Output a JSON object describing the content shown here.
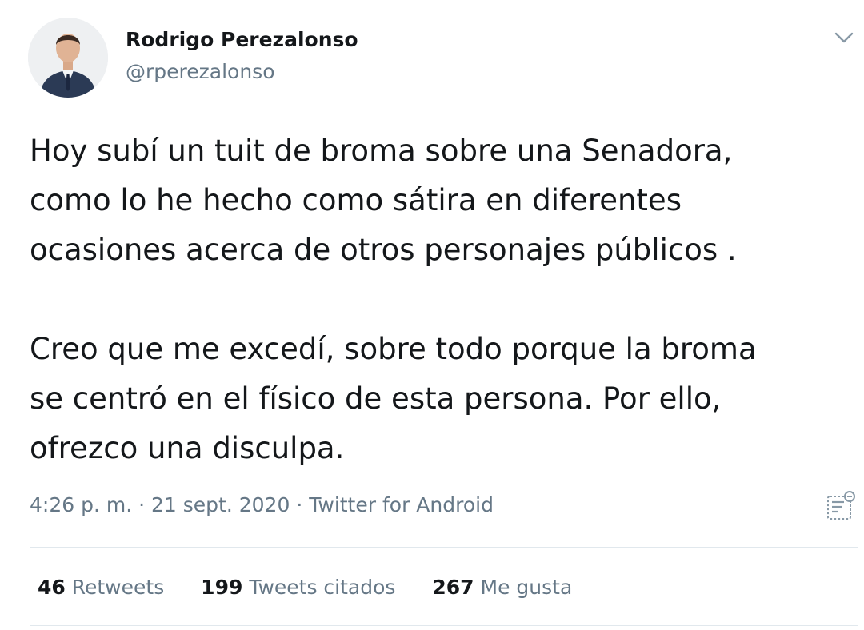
{
  "author": {
    "display_name": "Rodrigo Perezalonso",
    "handle": "@rperezalonso",
    "avatar_icon": "profile-photo"
  },
  "tweet": {
    "text": "Hoy subí un tuit de broma sobre una Senadora,\ncomo lo he hecho como sátira en diferentes\nocasiones acerca de otros personajes públicos .\n\nCreo que me excedí, sobre todo porque la broma\nse centró en el físico de esta persona. Por ello,\nofrezco una disculpa.",
    "time": "4:26 p. m.",
    "date": "21 sept. 2020",
    "source": "Twitter for Android",
    "separator": "·"
  },
  "stats": {
    "retweets_count": "46",
    "retweets_label": "Retweets",
    "quotes_count": "199",
    "quotes_label": "Tweets citados",
    "likes_count": "267",
    "likes_label": "Me gusta"
  },
  "icons": {
    "caret": "chevron-down-icon",
    "analytics": "analytics-icon"
  },
  "colors": {
    "primary_text": "#14171a",
    "secondary_text": "#657786",
    "divider": "#e1e8ed"
  }
}
